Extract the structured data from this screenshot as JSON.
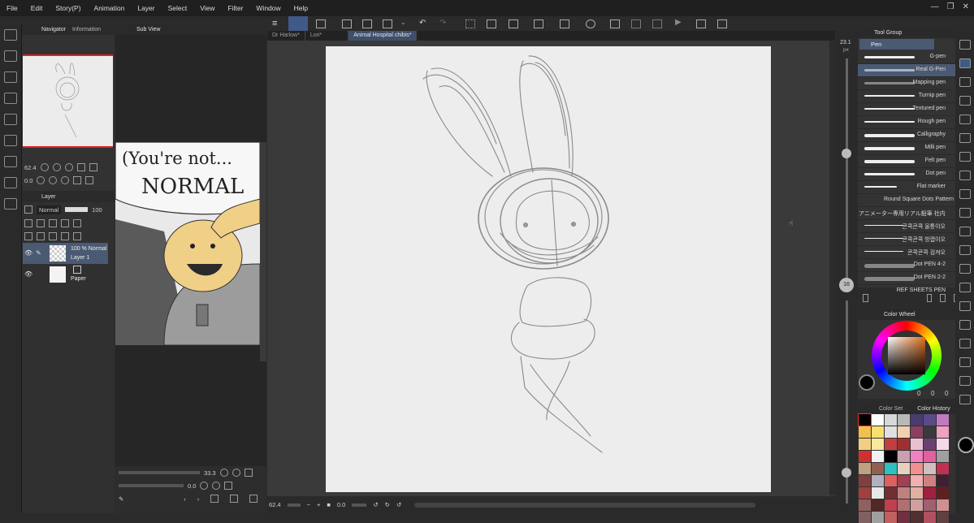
{
  "menubar": {
    "items": [
      "File",
      "Edit",
      "Story(P)",
      "Animation",
      "Layer",
      "Select",
      "View",
      "Filter",
      "Window",
      "Help"
    ]
  },
  "navigator": {
    "tabs": [
      "Navigator",
      "Information"
    ],
    "zoom": "62.4",
    "rotation": "0.0"
  },
  "subview": {
    "tab": "Sub View",
    "comic_text_1": "(You're not...",
    "comic_text_2": "NORMAL",
    "zoom": "33.3",
    "rotation": "0.0"
  },
  "layer_panel": {
    "tab": "Layer",
    "blend_mode": "Normal",
    "opacity": "100",
    "layers": [
      {
        "mode": "100 % Normal",
        "name": "Layer 1"
      },
      {
        "mode": "",
        "name": "Paper"
      }
    ]
  },
  "document_tabs": [
    "Dr Harlow*",
    "Lori*",
    "Animal Hospital chibis*"
  ],
  "status": {
    "zoom": "62.4",
    "rotation": "0.0"
  },
  "brush_size": {
    "value": "23.1",
    "unit": "px",
    "opacity": "16"
  },
  "tool_group": {
    "tab": "Tool Group",
    "sub_tool": "Pen",
    "brushes": [
      "G-pen",
      "Real G-Pen",
      "Mapping pen",
      "Turnip pen",
      "Textured pen",
      "Rough pen",
      "Calligraphy",
      "Milli pen",
      "Felt pen",
      "Dot pen",
      "Flat marker",
      "Round Square Dots Pattern",
      "アニメーター専用リアル鉛筆 社内",
      "콘콕콘콕 울퉁이오",
      "콘콕콘콕 방캡이오",
      "콘콕콘콕 검져오",
      "Dot PEN 4-2",
      "Dot PEN 2-2",
      "REF SHEETS PEN"
    ]
  },
  "color_wheel": {
    "tab": "Color Wheel",
    "v1": "0",
    "v2": "0",
    "v3": "0"
  },
  "color_set": {
    "tabs": [
      "Color Set",
      "Color History"
    ],
    "colors": [
      "#000000",
      "#ffffff",
      "#d8d8d8",
      "#b8b8b8",
      "#4a3b6e",
      "#5b4a8a",
      "#c07ac0",
      "#f0c050",
      "#f5e070",
      "#e0e0e0",
      "#f0d0b0",
      "#8a4060",
      "#3a3a3a",
      "#f0a0c0",
      "#f0d080",
      "#f8e8a0",
      "#c04040",
      "#a03030",
      "#e8c0d0",
      "#6a4070",
      "#f8d8e8",
      "#d03030",
      "#f0f0f0",
      "#000000",
      "#c8a0b0",
      "#f080c0",
      "#e060a0",
      "#a0a0a0",
      "#c0a080",
      "#906050",
      "#30c0c0",
      "#e8d0c0",
      "#f09090",
      "#d0c0c0",
      "#c03050",
      "#804040",
      "#b0b0c0",
      "#e06060",
      "#a04050",
      "#f0b0b0",
      "#d08080",
      "#402030",
      "#a04040",
      "#e8e8e8",
      "#703030",
      "#c08080",
      "#e0b0a0",
      "#a02040",
      "#602020",
      "#906060",
      "#502828",
      "#c04050",
      "#b07070",
      "#d0a0a0",
      "#a06070",
      "#d09090",
      "#806060",
      "#a0a0a0",
      "#c06060",
      "#703040",
      "#503030",
      "#b05060",
      "#604040"
    ],
    "accent_main": "#000000"
  }
}
